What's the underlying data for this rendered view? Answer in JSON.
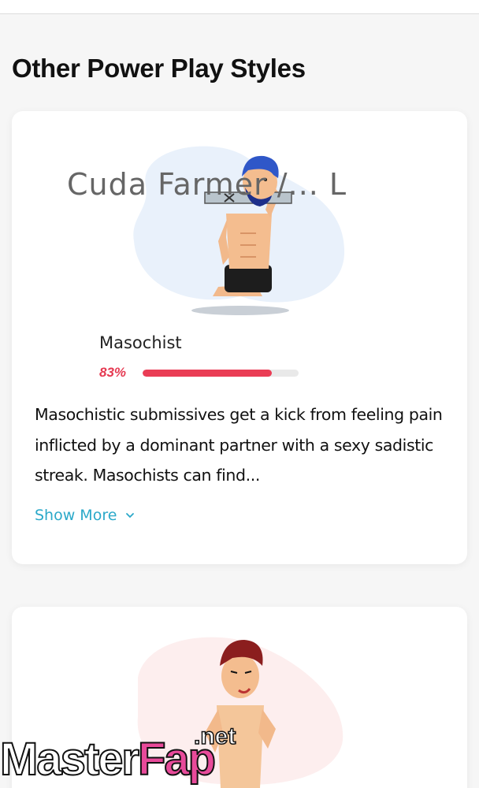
{
  "header": {
    "section_title": "Other Power Play Styles"
  },
  "cards": [
    {
      "name": "Masochist",
      "percent_label": "83%",
      "percent_value": 0.83,
      "description": "Masochistic submissives get a kick from feeling pain inflicted by a dominant partner with a sexy sadistic streak. Masochists can find...",
      "show_more_label": "Show More",
      "illustration_icon": "kneeling-bound-man-illustration",
      "blob_color": "#e9f1fb"
    },
    {
      "illustration_icon": "boxing-man-illustration",
      "blob_color": "#fdeeee",
      "partial_text": "Cuda Farmer /... L"
    }
  ],
  "watermark": {
    "part1": "Master",
    "part2": "Fap",
    "part3": ".net"
  },
  "colors": {
    "accent": "#ea3d55",
    "link": "#2ba9c9",
    "background": "#f6f6f6"
  }
}
